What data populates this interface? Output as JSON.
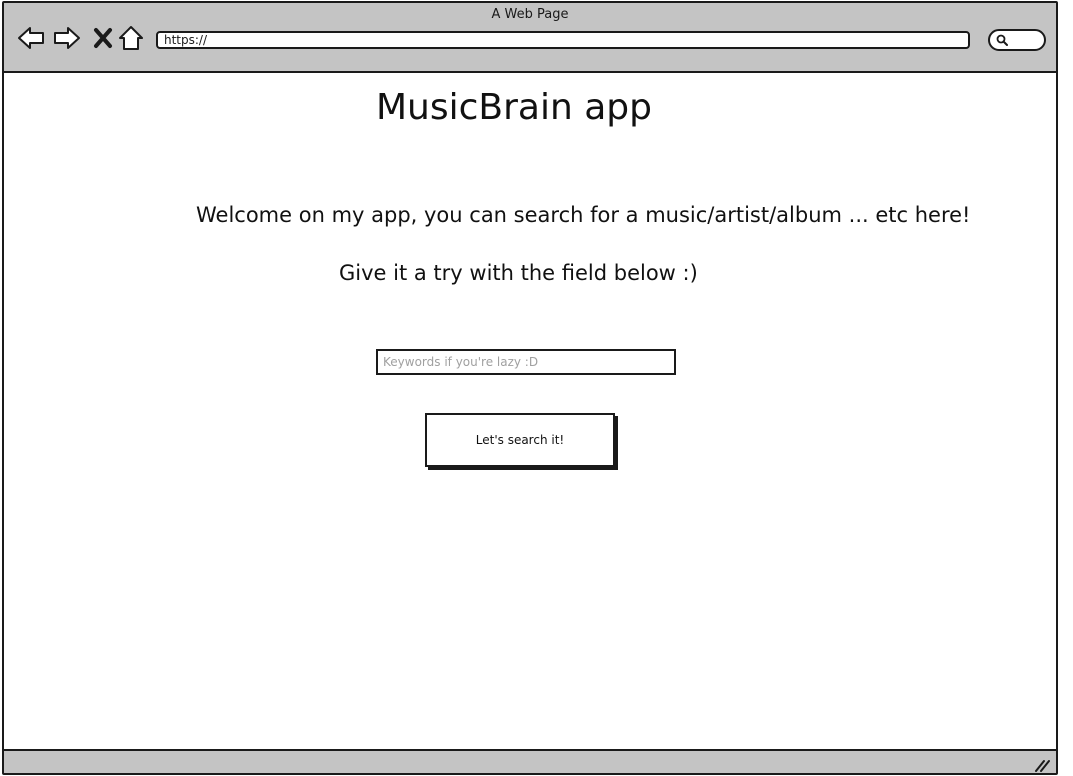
{
  "window": {
    "title": "A Web Page"
  },
  "toolbar": {
    "icons": [
      "back-arrow-icon",
      "forward-arrow-icon",
      "close-icon",
      "home-icon",
      "search-icon"
    ],
    "address_value": "https://"
  },
  "main": {
    "title": "MusicBrain app",
    "welcome_text": "Welcome on my app, you can search for a music/artist/album ... etc here!",
    "prompt_text": "Give it a try with the field below :)",
    "search_input": {
      "value": "",
      "placeholder": "Keywords if you're lazy :D"
    },
    "search_button_label": "Let's search it!"
  },
  "colors": {
    "chrome": "#c4c4c4",
    "stroke": "#1a1a1a",
    "background": "#ffffff",
    "placeholder": "#a0a0a0"
  }
}
